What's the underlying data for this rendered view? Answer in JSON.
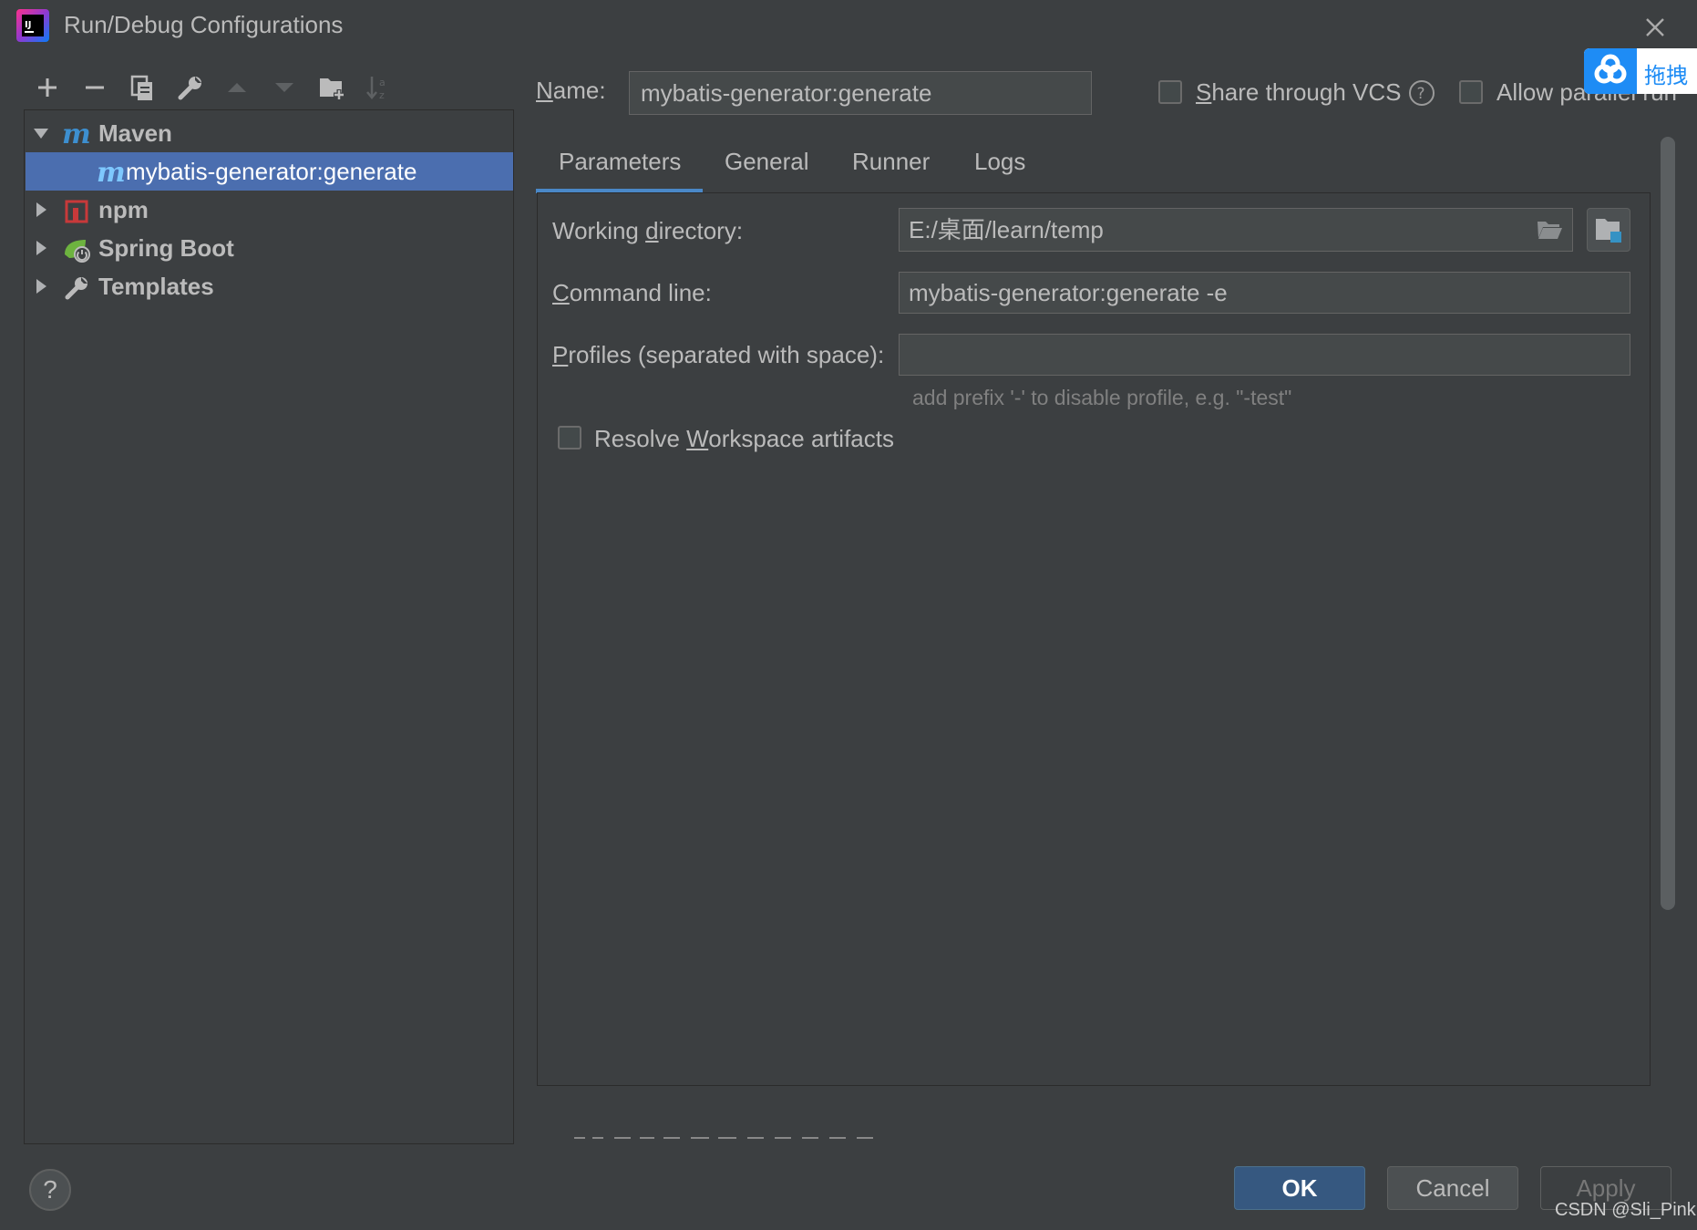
{
  "window": {
    "title": "Run/Debug Configurations",
    "icon": "intellij-idea-icon"
  },
  "overlay": {
    "text": "拖拽",
    "icon": "baidu-netdisk-cloud-icon"
  },
  "toolbar": {
    "icons": [
      "add-icon",
      "remove-icon",
      "copy-icon",
      "wrench-icon",
      "move-up-icon",
      "move-down-icon",
      "new-folder-icon",
      "sort-icon"
    ]
  },
  "tree": {
    "groups": [
      {
        "label": "Maven",
        "expanded": true,
        "icon": "maven-icon"
      },
      {
        "label": "npm",
        "expanded": false,
        "icon": "npm-icon"
      },
      {
        "label": "Spring Boot",
        "expanded": false,
        "icon": "spring-boot-icon"
      },
      {
        "label": "Templates",
        "expanded": false,
        "icon": "wrench-icon"
      }
    ],
    "selected_child": {
      "label": "mybatis-generator:generate",
      "icon": "maven-icon"
    }
  },
  "form": {
    "name_label_mnemonic": "N",
    "name_label_rest": "ame:",
    "name_value": "mybatis-generator:generate",
    "share_vcs_mnemonic": "S",
    "share_vcs_rest": "hare through VCS",
    "share_vcs_checked": false,
    "allow_parallel_label": "Allow parallel run",
    "allow_parallel_checked": false
  },
  "tabs": [
    "Parameters",
    "General",
    "Runner",
    "Logs"
  ],
  "active_tab": "Parameters",
  "parameters": {
    "working_dir_pre": "Working ",
    "working_dir_mnemonic": "d",
    "working_dir_post": "irectory:",
    "working_dir_value": "E:/桌面/learn/temp",
    "command_line_mnemonic": "C",
    "command_line_rest": "ommand line:",
    "command_line_value": "mybatis-generator:generate -e",
    "profiles_mnemonic": "P",
    "profiles_rest": "rofiles (separated with space):",
    "profiles_value": "",
    "profiles_hint": "add prefix '-' to disable profile, e.g. \"-test\"",
    "resolve_pre": "Resolve ",
    "resolve_mnemonic": "W",
    "resolve_post": "orkspace artifacts",
    "resolve_checked": false
  },
  "buttons": {
    "ok": "OK",
    "cancel": "Cancel",
    "apply": "Apply",
    "help": "?"
  },
  "watermark": "CSDN @Sli_Pink",
  "colors": {
    "background": "#3c3f41",
    "selection": "#4b6eaf",
    "accent": "#4a88c7",
    "ok_button": "#365880"
  }
}
